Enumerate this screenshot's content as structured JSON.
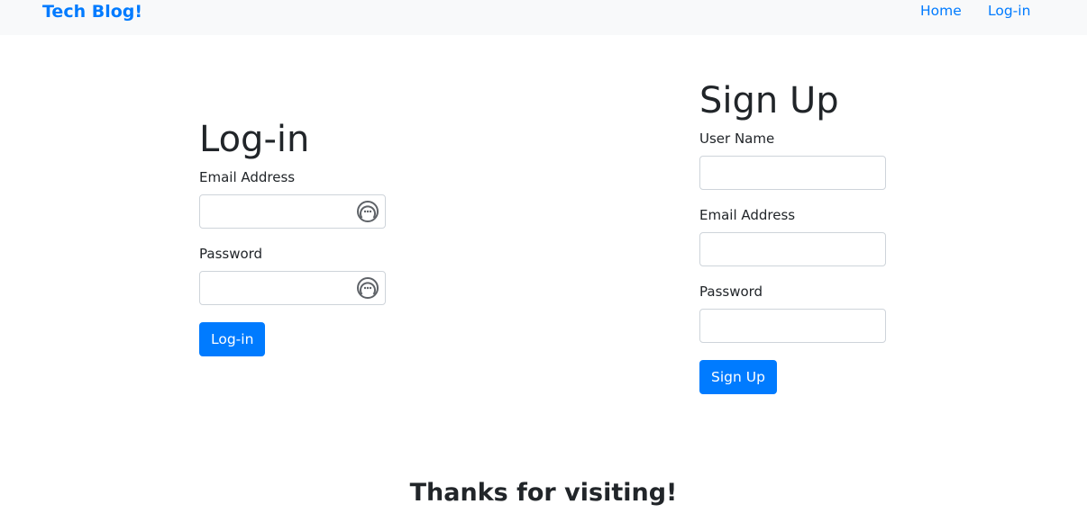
{
  "navbar": {
    "brand": "Tech Blog!",
    "links": [
      "Home",
      "Log-in"
    ]
  },
  "login": {
    "title": "Log-in",
    "email_label": "Email Address",
    "password_label": "Password",
    "email_value": "",
    "password_value": "",
    "field_icon": "password-manager-icon",
    "button_label": "Log-in"
  },
  "signup": {
    "title": "Sign Up",
    "username_label": "User Name",
    "email_label": "Email Address",
    "password_label": "Password",
    "username_value": "",
    "email_value": "",
    "password_value": "",
    "button_label": "Sign Up"
  },
  "footer": {
    "text": "Thanks for visiting!"
  },
  "colors": {
    "accent": "#007bff",
    "navbar_bg": "#f8f9fa",
    "text": "#212529",
    "input_border": "#ced4da"
  }
}
